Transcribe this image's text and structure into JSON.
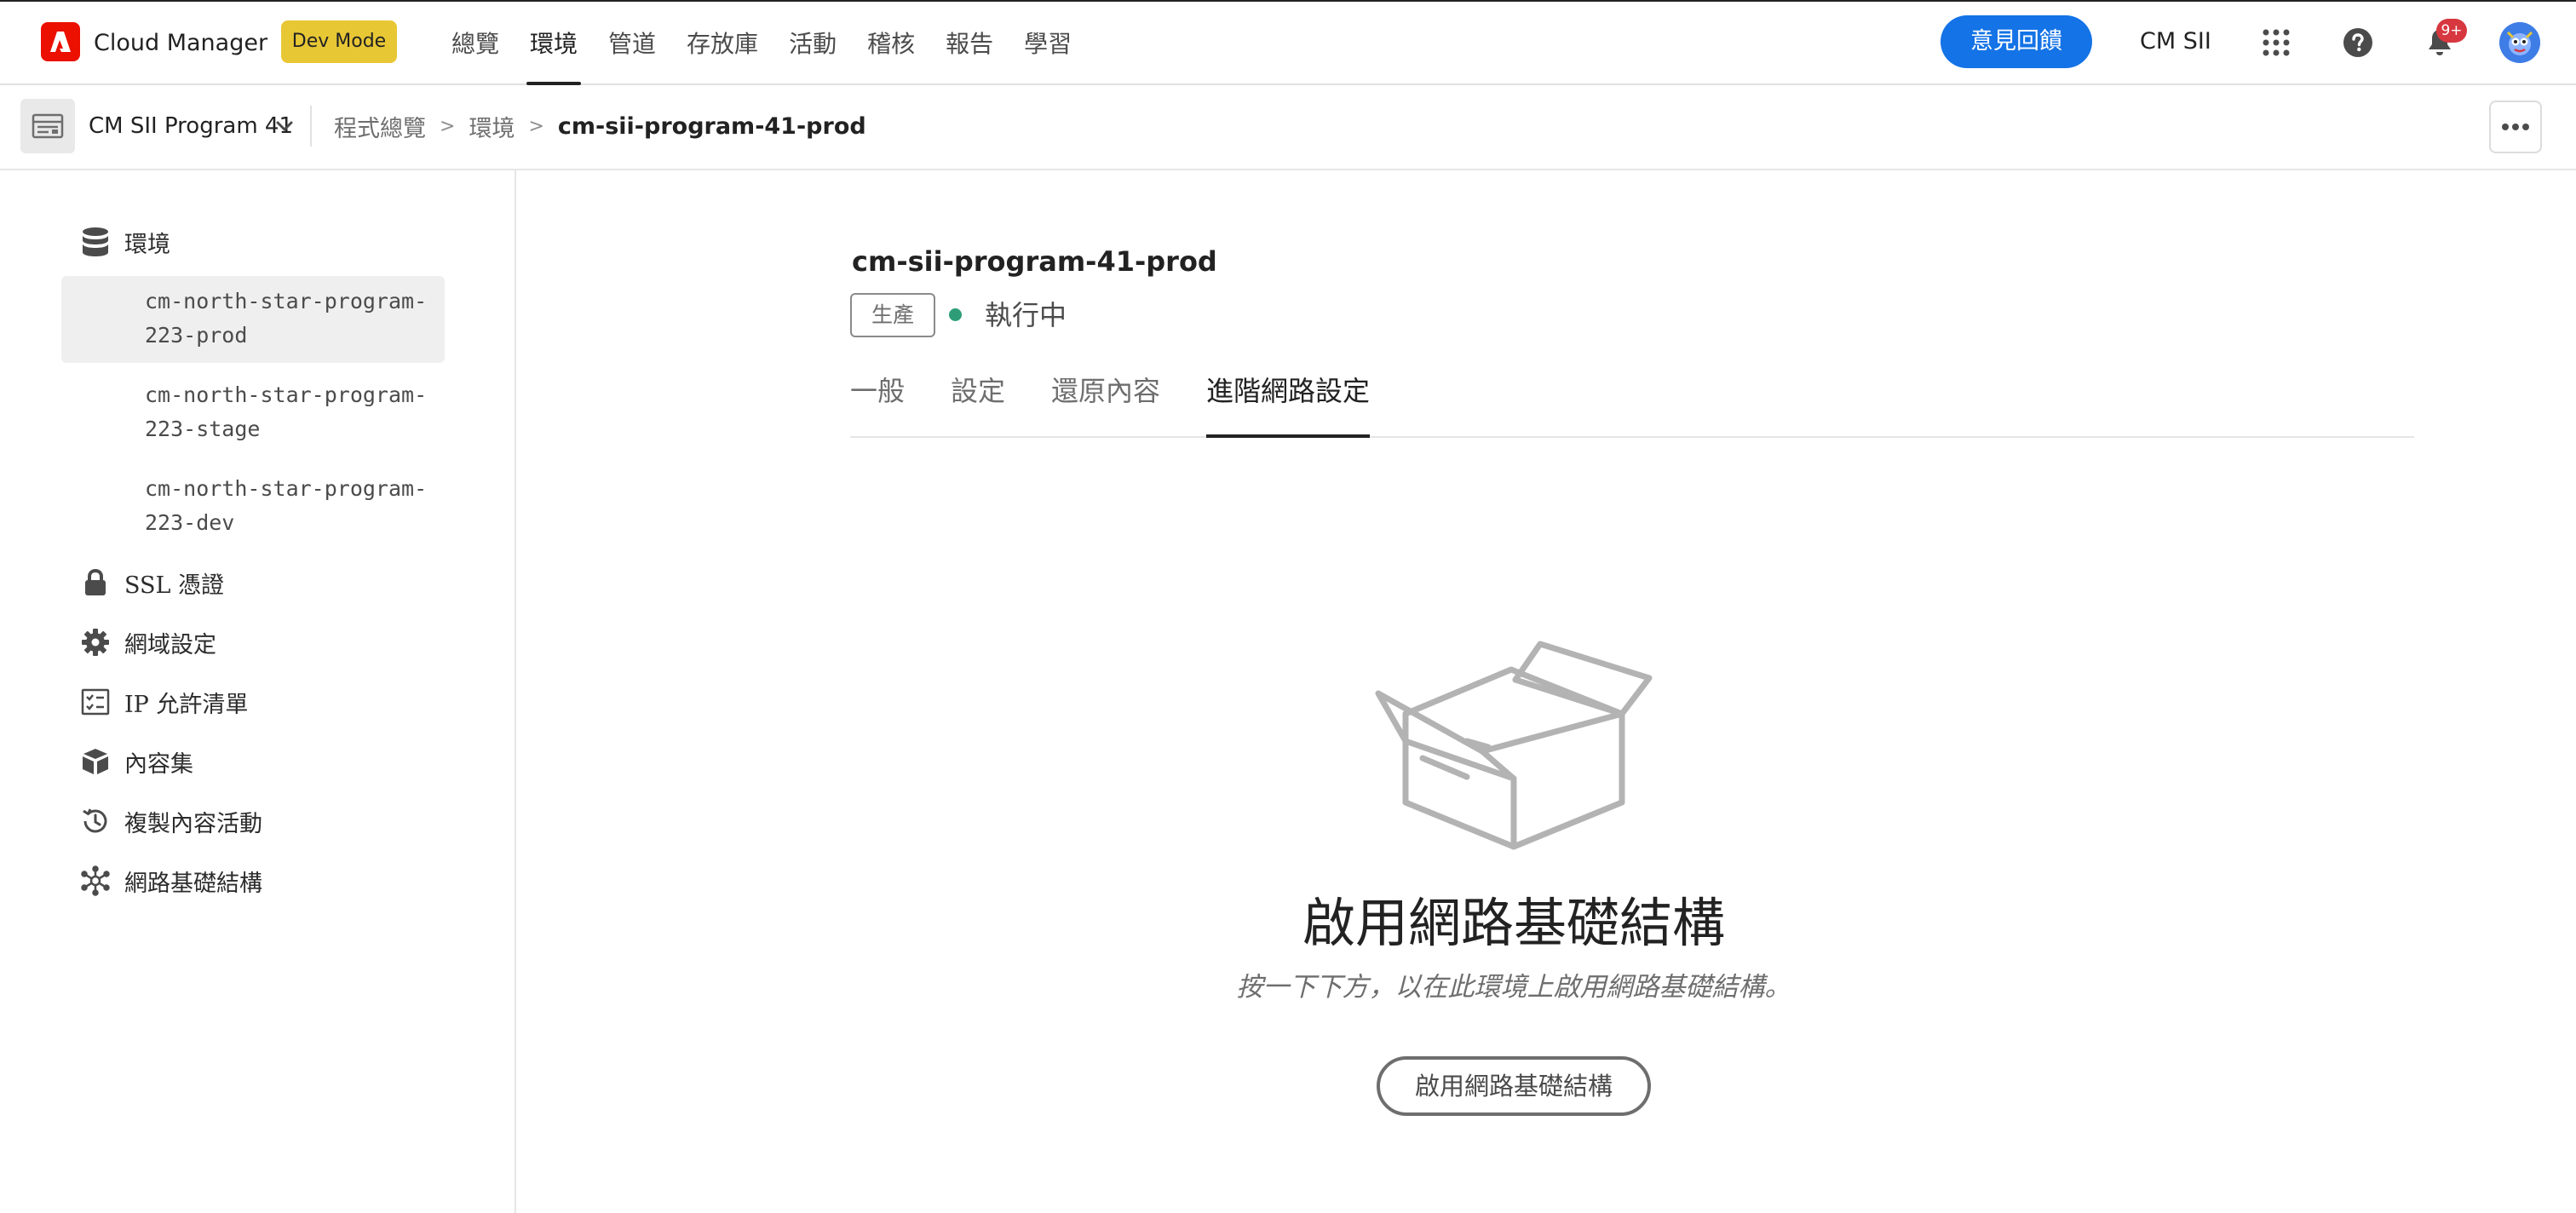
{
  "app": {
    "title": "Cloud Manager",
    "dev_mode_label": "Dev Mode"
  },
  "topnav": {
    "items": [
      {
        "label": "總覽"
      },
      {
        "label": "環境",
        "active": true
      },
      {
        "label": "管道"
      },
      {
        "label": "存放庫"
      },
      {
        "label": "活動"
      },
      {
        "label": "稽核"
      },
      {
        "label": "報告"
      },
      {
        "label": "學習"
      }
    ]
  },
  "header_right": {
    "feedback_label": "意見回饋",
    "org_name": "CM SII",
    "notifications_badge": "9+",
    "icons": [
      "apps-grid-icon",
      "help-icon",
      "bell-icon",
      "avatar"
    ]
  },
  "breadcrumb": {
    "program_name": "CM SII Program 41",
    "items": [
      {
        "label": "程式總覽"
      },
      {
        "label": "環境"
      },
      {
        "label": "cm-sii-program-41-prod",
        "current": true
      }
    ],
    "separator": ">"
  },
  "sidebar": {
    "environments_label": "環境",
    "environments": [
      {
        "line1": "cm-north-star-program-",
        "line2": "223-prod",
        "selected": true
      },
      {
        "line1": "cm-north-star-program-",
        "line2": "223-stage"
      },
      {
        "line1": "cm-north-star-program-",
        "line2": "223-dev"
      }
    ],
    "items": [
      {
        "label": "SSL 憑證",
        "icon": "lock-icon"
      },
      {
        "label": "網域設定",
        "icon": "gear-icon"
      },
      {
        "label": "IP 允許清單",
        "icon": "checklist-icon"
      },
      {
        "label": "內容集",
        "icon": "cubes-icon"
      },
      {
        "label": "複製內容活動",
        "icon": "history-icon"
      },
      {
        "label": "網路基礎結構",
        "icon": "network-icon"
      }
    ]
  },
  "main": {
    "env_title": "cm-sii-program-41-prod",
    "env_type_tag": "生產",
    "status": "執行中",
    "status_color": "#2d9d78",
    "tabs": [
      {
        "label": "一般"
      },
      {
        "label": "設定"
      },
      {
        "label": "還原內容"
      },
      {
        "label": "進階網路設定",
        "active": true
      }
    ],
    "empty_state": {
      "icon": "empty-box-icon",
      "title": "啟用網路基礎結構",
      "description": "按一下下方，以在此環境上啟用網路基礎結構。",
      "button_label": "啟用網路基礎結構"
    }
  },
  "colors": {
    "brand_red": "#eb1000",
    "accent_blue": "#1473e6",
    "dev_mode_yellow": "#e8c735",
    "badge_red": "#d7373f"
  }
}
